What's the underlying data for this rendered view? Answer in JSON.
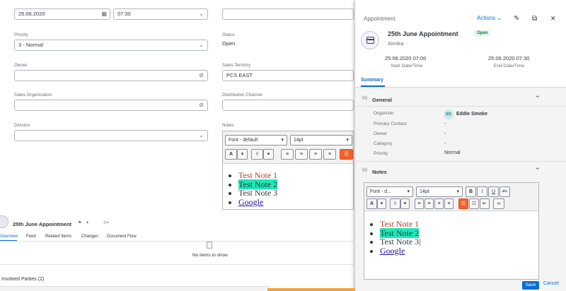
{
  "form": {
    "date_value": "25.06.2020",
    "time_value": "07:30",
    "priority_label": "Priority",
    "priority_value": "3 - Normal",
    "status_label": "Status",
    "status_value": "Open",
    "owner_label": "Owner",
    "territory_label": "Sales Territory",
    "territory_value": "PCS EAST",
    "sales_org_label": "Sales Organization",
    "dist_channel_label": "Distribution Channel",
    "division_label": "Division",
    "notes_label": "Notes",
    "font_select": "Font - default",
    "size_select": "14pt",
    "notes": [
      "Test Note 1",
      "Test Note 2",
      "Test Note 3",
      "Google"
    ]
  },
  "lower": {
    "title": "25th June Appointment",
    "tabs": [
      "Overview",
      "Feed",
      "Related Items",
      "Changes",
      "Document Flow"
    ],
    "empty_text": "No items to show",
    "involved_label": "Involved Parties",
    "involved_count": "(2)"
  },
  "panel": {
    "header_label": "Appointment",
    "actions_label": "Actions",
    "title": "25th June Appointment",
    "subtitle": "Almika",
    "status_badge": "Open",
    "start_value": "25.06.2020 07:00",
    "start_label": "Start Date/Time",
    "end_value": "25.06.2020 07:30",
    "end_label": "End Date/Time",
    "tab_summary": "Summary",
    "general_title": "General",
    "general": {
      "organizer_label": "Organizer",
      "organizer_initials": "ES",
      "organizer_value": "Eddie Smoke",
      "primary_contact_label": "Primary Contact",
      "primary_contact_value": "-",
      "owner_label": "Owner",
      "owner_value": "-",
      "category_label": "Category",
      "category_value": "-",
      "priority_label": "Priority",
      "priority_value": "Normal"
    },
    "notes_title": "Notes",
    "font_select": "Font - d...",
    "size_select": "14pt",
    "notes": [
      "Test Note 1",
      "Test Note 2",
      "Test Note 3",
      "Google"
    ],
    "save_label": "Save",
    "cancel_label": "Cancel"
  },
  "colors": {
    "accent": "#0a6ed1",
    "highlight": "#1de9b6",
    "note_red": "#c0392b",
    "orange": "#f2622a"
  }
}
